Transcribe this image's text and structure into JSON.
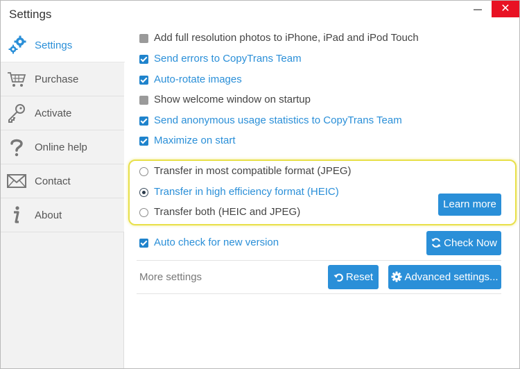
{
  "window": {
    "title": "Settings",
    "close_glyph": "✕"
  },
  "sidebar": {
    "items": [
      {
        "label": "Settings",
        "icon": "gears-icon",
        "active": true
      },
      {
        "label": "Purchase",
        "icon": "cart-icon"
      },
      {
        "label": "Activate",
        "icon": "key-icon"
      },
      {
        "label": "Online help",
        "icon": "question-icon"
      },
      {
        "label": "Contact",
        "icon": "envelope-icon"
      },
      {
        "label": "About",
        "icon": "info-icon"
      }
    ]
  },
  "options": [
    {
      "label": "Add full resolution photos to iPhone, iPad and iPod Touch",
      "checked": false
    },
    {
      "label": "Send errors to CopyTrans Team",
      "checked": true
    },
    {
      "label": "Auto-rotate images",
      "checked": true
    },
    {
      "label": "Show welcome window on startup",
      "checked": false
    },
    {
      "label": "Send anonymous usage statistics to CopyTrans Team",
      "checked": true
    },
    {
      "label": "Maximize on start",
      "checked": true
    }
  ],
  "format": {
    "options": [
      {
        "label": "Transfer in most compatible format (JPEG)",
        "selected": false
      },
      {
        "label": "Transfer in high efficiency format (HEIC)",
        "selected": true
      },
      {
        "label": "Transfer both (HEIC and JPEG)",
        "selected": false
      }
    ],
    "learn_more": "Learn more"
  },
  "update": {
    "label": "Auto check for new version",
    "checked": true,
    "check_now": "Check Now"
  },
  "more": {
    "label": "More settings",
    "reset": "Reset",
    "advanced": "Advanced settings..."
  },
  "colors": {
    "accent": "#2a8fd8",
    "highlight": "#e8e04a",
    "close": "#e81123"
  }
}
